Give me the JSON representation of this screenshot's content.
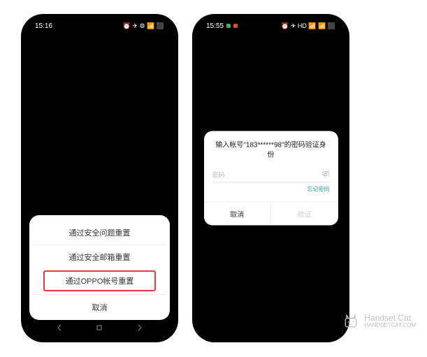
{
  "phone1": {
    "status": {
      "time": "15:16",
      "icons": "⏰ ✈ ⚙ 📶 ⬛"
    },
    "sheet": {
      "option1": "通过安全问题重置",
      "option2": "通过安全邮箱重置",
      "option3_highlighted": "通过OPPO帐号重置",
      "cancel": "取消"
    },
    "nav": {
      "back": "◁",
      "home": "□",
      "recent": "◁"
    }
  },
  "phone2": {
    "status": {
      "time": "15:55",
      "icons": "⏰ ✈ HD 📶 📶 ⬛"
    },
    "dialog": {
      "title": "输入帐号\"183******98\"的密码验证身份",
      "password_placeholder": "密码",
      "forgot": "忘记密码",
      "cancel": "取消",
      "confirm": "验证"
    }
  },
  "watermark": {
    "text": "Handset Cat",
    "url": "HANDSETCAT.COM"
  }
}
